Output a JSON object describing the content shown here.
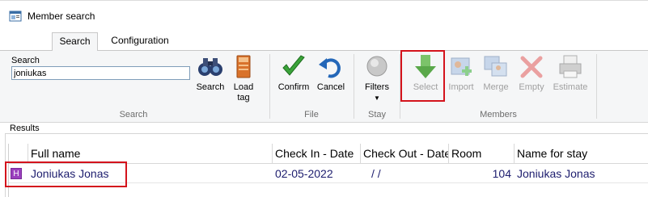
{
  "window": {
    "title": "Member search"
  },
  "tabs": [
    {
      "label": "Search",
      "active": true
    },
    {
      "label": "Configuration",
      "active": false
    }
  ],
  "ribbon": {
    "search_group": {
      "label": "Search",
      "field_label": "Search",
      "field_value": "joniukas",
      "search_button": "Search",
      "load_tag_button_line1": "Load",
      "load_tag_button_line2": "tag"
    },
    "file_group": {
      "label": "File",
      "confirm_button": "Confirm",
      "cancel_button": "Cancel"
    },
    "stay_group": {
      "label": "Stay",
      "filters_button": "Filters"
    },
    "members_group": {
      "label": "Members",
      "select_button": "Select",
      "import_button": "Import",
      "merge_button": "Merge",
      "empty_button": "Empty",
      "estimate_button": "Estimate"
    }
  },
  "results": {
    "label": "Results",
    "columns": [
      "Full name",
      "Check In - Date",
      "Check Out - Date",
      "Room",
      "Name for stay"
    ],
    "rows": [
      {
        "indicator": "H",
        "full_name": "Joniukas Jonas",
        "check_in": "02-05-2022",
        "check_out": "/ /",
        "room": "104",
        "name_for_stay": "Joniukas Jonas"
      }
    ]
  },
  "colors": {
    "highlight": "#d4131c",
    "row_text": "#1d1d6e",
    "indicator": "#9a3fbd"
  }
}
